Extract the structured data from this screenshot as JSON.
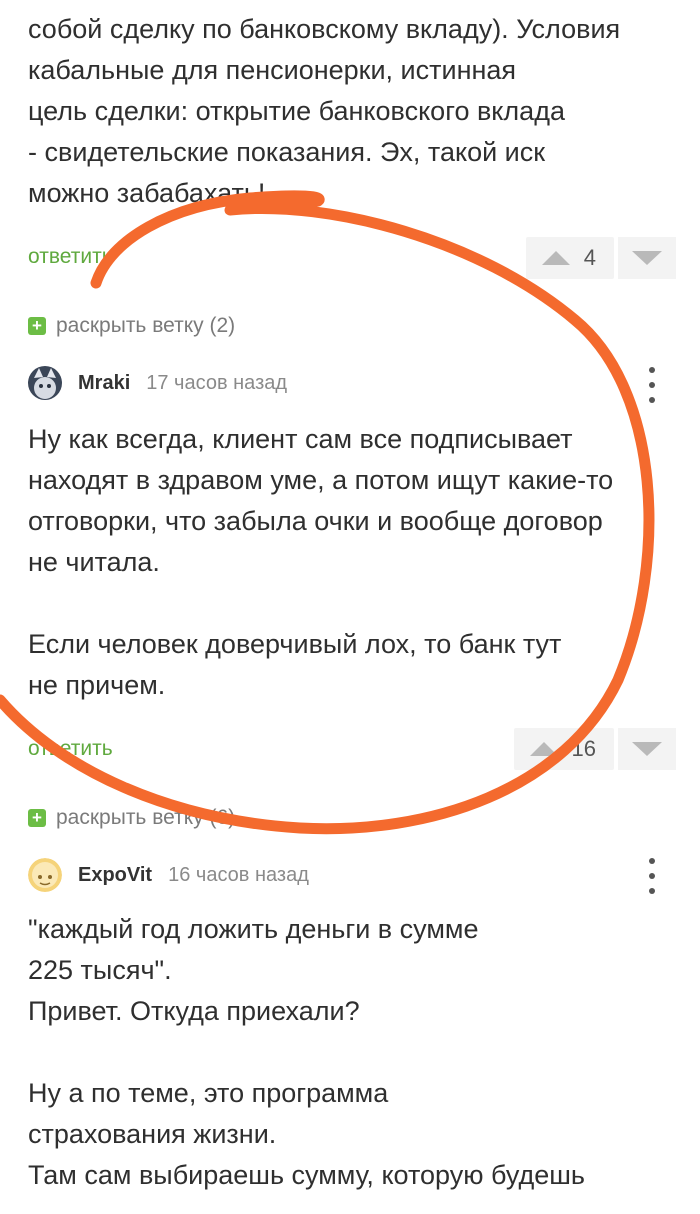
{
  "top_comment": {
    "text_lines": [
      "собой сделку по банковскому вкладу). Условия",
      "кабальные для пенсионерки, истинная",
      "цель сделки: открытие банковского вклада",
      "- свидетельские показания. Эх, такой иск",
      "можно забабахать!"
    ],
    "reply_label": "ответить",
    "votes": "4"
  },
  "thread_1": {
    "expand_label": "раскрыть ветку (2)"
  },
  "comment_mraki": {
    "username": "Mraki",
    "timestamp": "17 часов назад",
    "text": "Ну как всегда, клиент сам все подписывает\nнаходят в здравом уме, а потом ищут какие-то\nотговорки, что забыла очки и вообще договор\nне читала.\n\nЕсли человек доверчивый лох, то банк тут\nне причем.",
    "reply_label": "ответить",
    "votes": "16"
  },
  "thread_2": {
    "expand_label": "раскрыть ветку (6)"
  },
  "comment_expovit": {
    "username": "ExpoVit",
    "timestamp": "16 часов назад",
    "text": "\"каждый год ложить деньги в сумме\n225 тысяч\".\nПривет. Откуда приехали?\n\nНу а по теме, это программа\nстрахования жизни.\nТам сам выбираешь сумму, которую будешь"
  },
  "icons": {
    "upvote": "triangle-up-icon",
    "downvote": "triangle-down-icon",
    "expand": "plus-icon",
    "more": "vertical-dots-icon"
  },
  "colors": {
    "reply_link": "#5fa93e",
    "expand_plus": "#6cbd45",
    "annotation_stroke": "#f46a2e"
  }
}
